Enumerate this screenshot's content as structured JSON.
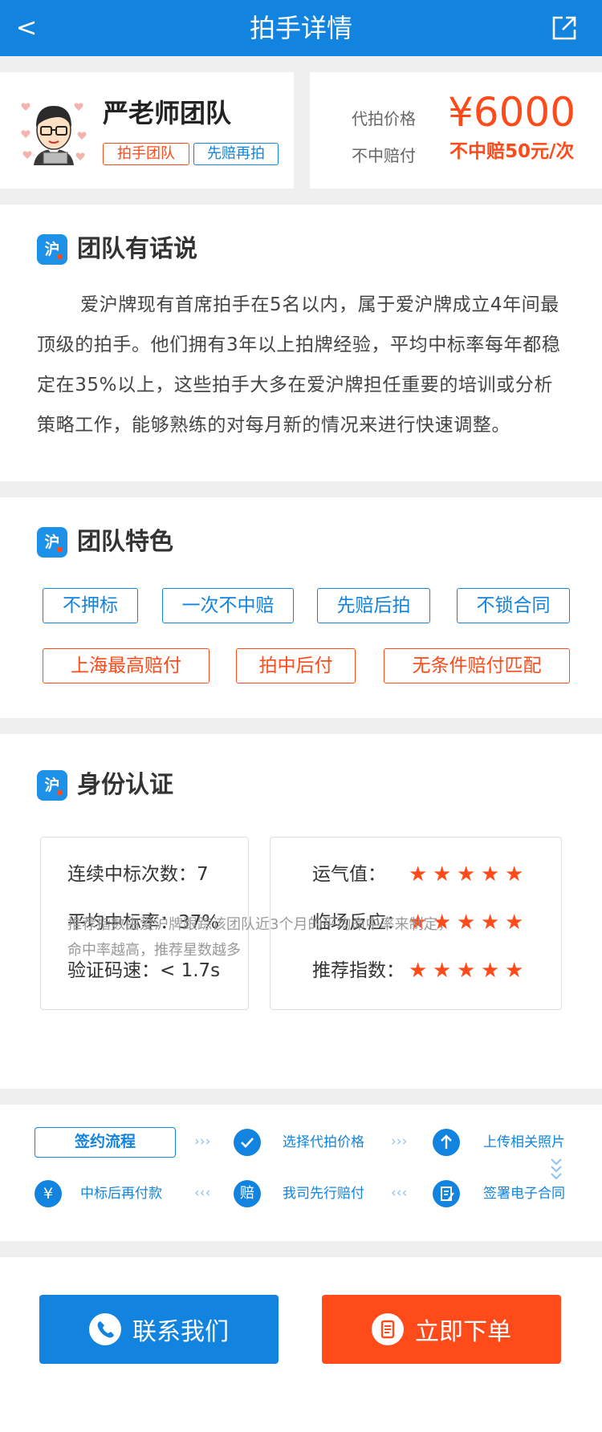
{
  "header": {
    "title": "拍手详情",
    "back_icon": "<",
    "share_icon": "share-icon"
  },
  "profile": {
    "team_name": "严老师团队",
    "tags": [
      "拍手团队",
      "先赔再拍"
    ],
    "price_label": "代拍价格",
    "price_value": "¥6000",
    "comp_label": "不中赔付",
    "comp_value": "不中赔50元/次"
  },
  "talk": {
    "title": "团队有话说",
    "body": "爱沪牌现有首席拍手在5名以内，属于爱沪牌成立4年间最顶级的拍手。他们拥有3年以上拍牌经验，平均中标率每年都稳定在35%以上，这些拍手大多在爱沪牌担任重要的培训或分析策略工作，能够熟练的对每月新的情况来进行快速调整。"
  },
  "features": {
    "title": "团队特色",
    "blue": [
      "不押标",
      "一次不中赔",
      "先赔后拍",
      "不锁合同"
    ],
    "orange": [
      "上海最高赔付",
      "拍中后付",
      "无条件赔付匹配"
    ]
  },
  "identity": {
    "title": "身份认证",
    "stats": [
      {
        "label": "连续中标次数：",
        "value": "7"
      },
      {
        "label": "平均中标率：",
        "value": "37%"
      },
      {
        "label": "验证码速：",
        "value": "< 1.7s"
      }
    ],
    "ratings": [
      {
        "label": "运气值：",
        "stars": 5
      },
      {
        "label": "临场反应：",
        "stars": 5
      },
      {
        "label": "推荐指数：",
        "stars": 5
      }
    ],
    "note_line1": "推荐指数由爱沪牌跟踪该团队近3个月的平均命中率来制定，",
    "note_line2": "命中率越高，推荐星数越多"
  },
  "flow": {
    "title": "签约流程",
    "steps": [
      "选择代拍价格",
      "上传相关照片",
      "签署电子合同",
      "我司先行赔付",
      "中标后再付款"
    ],
    "step_icons": [
      "check-icon",
      "upload-icon",
      "contract-icon",
      "赔",
      "¥"
    ],
    "arrow_right": "›››",
    "arrow_left": "‹‹‹"
  },
  "actions": {
    "contact": "联系我们",
    "order": "立即下单"
  },
  "colors": {
    "primary": "#1283de",
    "accent": "#ff4a1a"
  }
}
